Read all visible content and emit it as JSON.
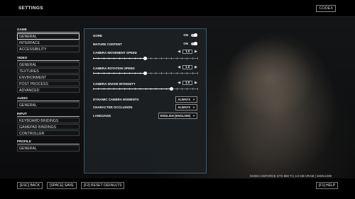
{
  "header": {
    "title": "SETTINGS",
    "badge": "CODEX"
  },
  "sidebar": {
    "groups": [
      {
        "label": "GAME",
        "items": [
          "GENERAL",
          "INTERFACE",
          "ACCESSIBILITY"
        ],
        "active": 0
      },
      {
        "label": "VIDEO",
        "items": [
          "GENERAL",
          "TEXTURES",
          "ENVIRONMENT",
          "POST PROCESS",
          "ADVANCED"
        ]
      },
      {
        "label": "AUDIO",
        "items": [
          "GENERAL"
        ]
      },
      {
        "label": "INPUT",
        "items": [
          "KEYBOARD BINDINGS",
          "GAMEPAD BINDINGS",
          "CONTROLLER"
        ]
      },
      {
        "label": "PROFILE",
        "items": [
          "GENERAL"
        ]
      }
    ]
  },
  "settings": {
    "gore": {
      "label": "GORE",
      "value": "ON"
    },
    "mature": {
      "label": "MATURE CONTENT",
      "value": "ON"
    },
    "cam_move": {
      "label": "CAMERA MOVEMENT SPEED",
      "value": "1.0",
      "level": 0.5
    },
    "cam_rot": {
      "label": "CAMERA ROTATION SPEED",
      "value": "1.0",
      "level": 0.5
    },
    "cam_shake": {
      "label": "CAMERA SHAKE INTENSITY",
      "value": "1.0",
      "level": 0.75
    },
    "dyn_cam": {
      "label": "DYNAMIC CAMERA MOMENTS",
      "value": "ALWAYS"
    },
    "occlusion": {
      "label": "CHARACTER OCCLUSION",
      "value": "ALWAYS"
    },
    "language": {
      "label": "LANGUAGE",
      "value": "ENGLISH (ENGLISH)"
    }
  },
  "status": {
    "gpu": "NVIDIA GEFORCE GTX 950 TI | 4.0 GB VRAM | 1920x1080"
  },
  "footer": {
    "back": "[ESC] BACK",
    "save": "[SPACE] SAVE",
    "reset": "[F2] RESET DEFAULTS",
    "help": "[F1] HELP"
  },
  "icons": {
    "left_arrow": "caret-left-icon",
    "right_arrow": "caret-right-icon",
    "dropdown": "chevron-down-icon"
  },
  "colors": {
    "panel_border": "#3e5868",
    "active_item_border": "#dcdcdc"
  }
}
